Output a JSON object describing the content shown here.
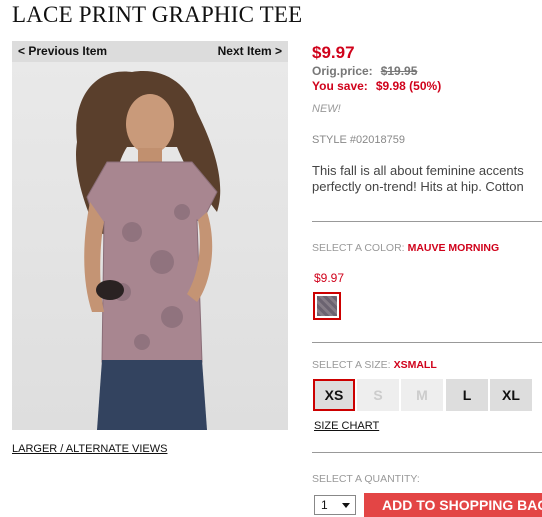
{
  "product": {
    "title": "LACE PRINT GRAPHIC TEE",
    "price": "$9.97",
    "orig_label": "Orig.price:",
    "orig_value": "$19.95",
    "save_label": "You save:",
    "save_value": "$9.98 (50%)",
    "badge": "NEW!",
    "style": "STYLE #02018759",
    "description_line1": "This fall is all about feminine accents",
    "description_line2": "perfectly on-trend! Hits at hip. Cotton"
  },
  "nav": {
    "prev": "< Previous Item",
    "next": "Next Item >"
  },
  "image": {
    "alt_views": "LARGER / ALTERNATE VIEWS"
  },
  "color": {
    "label": "SELECT A COLOR:",
    "selected": "MAUVE MORNING",
    "swatch_price": "$9.97"
  },
  "size": {
    "label": "SELECT A SIZE:",
    "selected": "XSMALL",
    "options": [
      "XS",
      "S",
      "M",
      "L",
      "XL"
    ],
    "size_chart": "SIZE CHART"
  },
  "quantity": {
    "label": "SELECT A QUANTITY:",
    "value": "1"
  },
  "cart": {
    "add_label": "ADD TO SHOPPING BAG"
  },
  "colors": {
    "accent_red": "#d0021b",
    "button_red": "#e34545"
  }
}
